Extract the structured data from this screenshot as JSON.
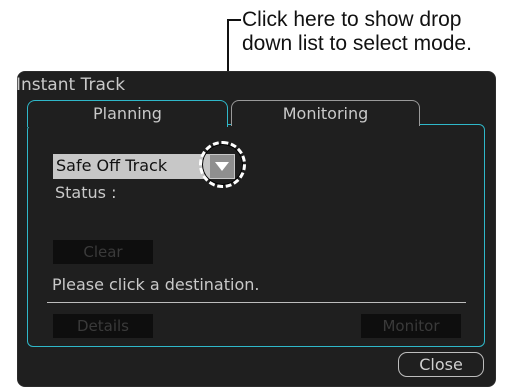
{
  "annotation": {
    "line1": "Click here to show drop",
    "line2": "down list to select mode."
  },
  "dialog": {
    "title": "Instant Track",
    "tabs": [
      {
        "label": "Planning",
        "active": true
      },
      {
        "label": "Monitoring",
        "active": false
      }
    ],
    "mode_select": {
      "value": "Safe Off Track"
    },
    "status_label": "Status :",
    "clear_label": "Clear",
    "hint": "Please click a destination.",
    "details_label": "Details",
    "monitor_label": "Monitor",
    "close_label": "Close"
  },
  "colors": {
    "accent": "#2fb8c9",
    "background": "#1f1f1f",
    "disabled_button": "#0e0e0e"
  },
  "icons": {
    "dropdown": "chevron-down-icon",
    "highlight": "dashed-circle"
  }
}
